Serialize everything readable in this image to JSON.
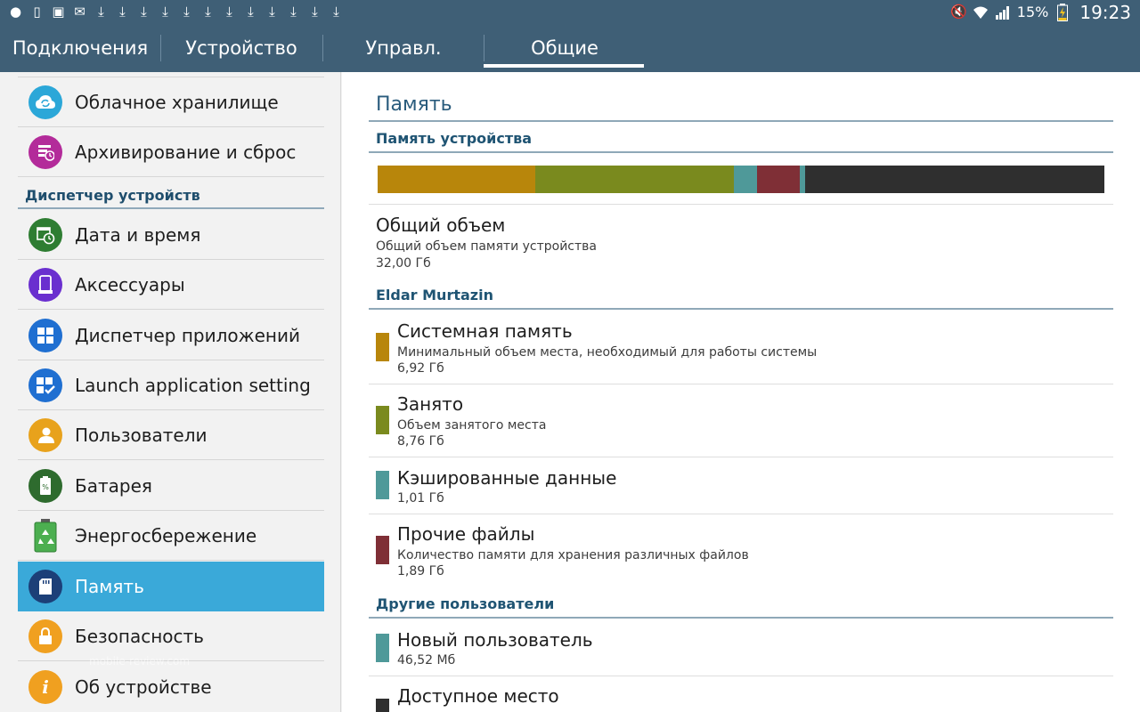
{
  "statusbar": {
    "left_icons": [
      "person-icon",
      "sim-icon",
      "image-icon",
      "mail-icon",
      "download-icon",
      "download-icon",
      "download-icon",
      "download-icon",
      "download-icon",
      "download-icon",
      "download-icon",
      "download-icon",
      "download-icon",
      "download-icon",
      "download-icon",
      "download-icon"
    ],
    "battery": "15%",
    "time": "19:23"
  },
  "tabs": [
    {
      "label": "Подключения"
    },
    {
      "label": "Устройство"
    },
    {
      "label": "Управл."
    },
    {
      "label": "Общие",
      "active": true
    }
  ],
  "sidebar": {
    "items": [
      {
        "label": "Облачное хранилище",
        "icon": "cloud-sync-icon",
        "color": "#2ba7d8"
      },
      {
        "label": "Архивирование и сброс",
        "icon": "backup-reset-icon",
        "color": "#b32b9a"
      },
      {
        "label": "Дата и время",
        "icon": "calendar-clock-icon",
        "color": "#2e7d32"
      },
      {
        "label": "Аксессуары",
        "icon": "accessory-icon",
        "color": "#6a2fcf"
      },
      {
        "label": "Диспетчер приложений",
        "icon": "apps-grid-icon",
        "color": "#1f6fd1"
      },
      {
        "label": "Launch application setting",
        "icon": "apps-check-icon",
        "color": "#1f6fd1"
      },
      {
        "label": "Пользователи",
        "icon": "users-icon",
        "color": "#e8a21c"
      },
      {
        "label": "Батарея",
        "icon": "battery-icon",
        "color": "#2e6b2e"
      },
      {
        "label": "Энергосбережение",
        "icon": "power-saving-icon",
        "color": "#4caf50"
      },
      {
        "label": "Память",
        "icon": "sd-card-icon",
        "color": "#1c3f78",
        "active": true
      },
      {
        "label": "Безопасность",
        "icon": "lock-icon",
        "color": "#f0a020"
      },
      {
        "label": "Об устройстве",
        "icon": "info-icon",
        "color": "#f0a020"
      }
    ],
    "header": "Диспетчер устройств"
  },
  "content": {
    "title": "Память",
    "device_memory_header": "Память устройства",
    "usage_bar": [
      {
        "name": "system",
        "fraction": 0.2163,
        "color": "#b8860b"
      },
      {
        "name": "used",
        "fraction": 0.2738,
        "color": "#7a8a1e"
      },
      {
        "name": "cached",
        "fraction": 0.0316,
        "color": "#4f9999"
      },
      {
        "name": "misc",
        "fraction": 0.0591,
        "color": "#7f2f36"
      },
      {
        "name": "other-users",
        "fraction": 0.0073,
        "color": "#4f9999"
      },
      {
        "name": "free",
        "fraction": 0.4119,
        "color": "#2f2f2f"
      }
    ],
    "total": {
      "title": "Общий объем",
      "subtitle": "Общий объем памяти устройства",
      "value": "32,00 Гб"
    },
    "user_header": "Eldar Murtazin",
    "rows": [
      {
        "title": "Системная память",
        "subtitle": "Минимальный объем места, необходимый для работы системы",
        "value": "6,92 Гб",
        "color": "#b8860b"
      },
      {
        "title": "Занято",
        "subtitle": "Объем занятого места",
        "value": "8,76 Гб",
        "color": "#7a8a1e"
      },
      {
        "title": "Кэшированные данные",
        "subtitle": "",
        "value": "1,01 Гб",
        "color": "#4f9999"
      },
      {
        "title": "Прочие файлы",
        "subtitle": "Количество памяти для хранения различных файлов",
        "value": "1,89 Гб",
        "color": "#7f2f36"
      }
    ],
    "other_users_header": "Другие пользователи",
    "other_rows": [
      {
        "title": "Новый пользователь",
        "value": "46,52 Мб",
        "color": "#4f9999"
      },
      {
        "title": "Доступное место",
        "value": "",
        "color": "#2f2f2f"
      }
    ]
  },
  "watermark": "mobile-review.com"
}
